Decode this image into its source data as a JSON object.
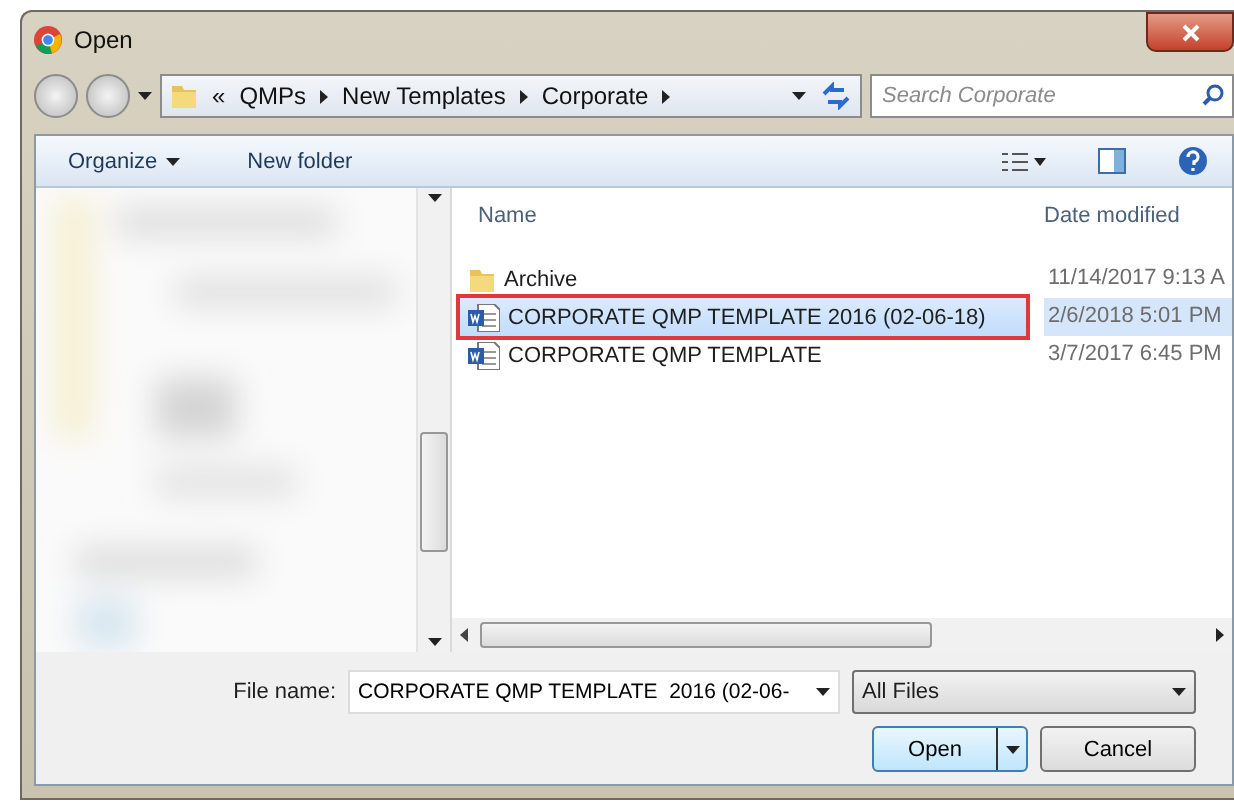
{
  "window": {
    "title": "Open"
  },
  "address_bar": {
    "overflow": "«",
    "crumbs": [
      "QMPs",
      "New Templates",
      "Corporate"
    ]
  },
  "search": {
    "placeholder": "Search Corporate"
  },
  "toolbar": {
    "organize": "Organize",
    "new_folder": "New folder"
  },
  "columns": [
    "Name",
    "Date modified"
  ],
  "files": [
    {
      "kind": "folder",
      "name": "Archive",
      "date": "11/14/2017 9:13 A",
      "selected": false,
      "highlighted": false
    },
    {
      "kind": "word",
      "name": "CORPORATE QMP TEMPLATE  2016 (02-06-18)",
      "date": "2/6/2018 5:01 PM",
      "selected": true,
      "highlighted": true
    },
    {
      "kind": "word",
      "name": "CORPORATE QMP TEMPLATE",
      "date": "3/7/2017 6:45 PM",
      "selected": false,
      "highlighted": false
    }
  ],
  "file_name": {
    "label": "File name:",
    "value": "CORPORATE QMP TEMPLATE  2016 (02-06-"
  },
  "file_type": {
    "value": "All Files"
  },
  "buttons": {
    "open": "Open",
    "cancel": "Cancel"
  }
}
